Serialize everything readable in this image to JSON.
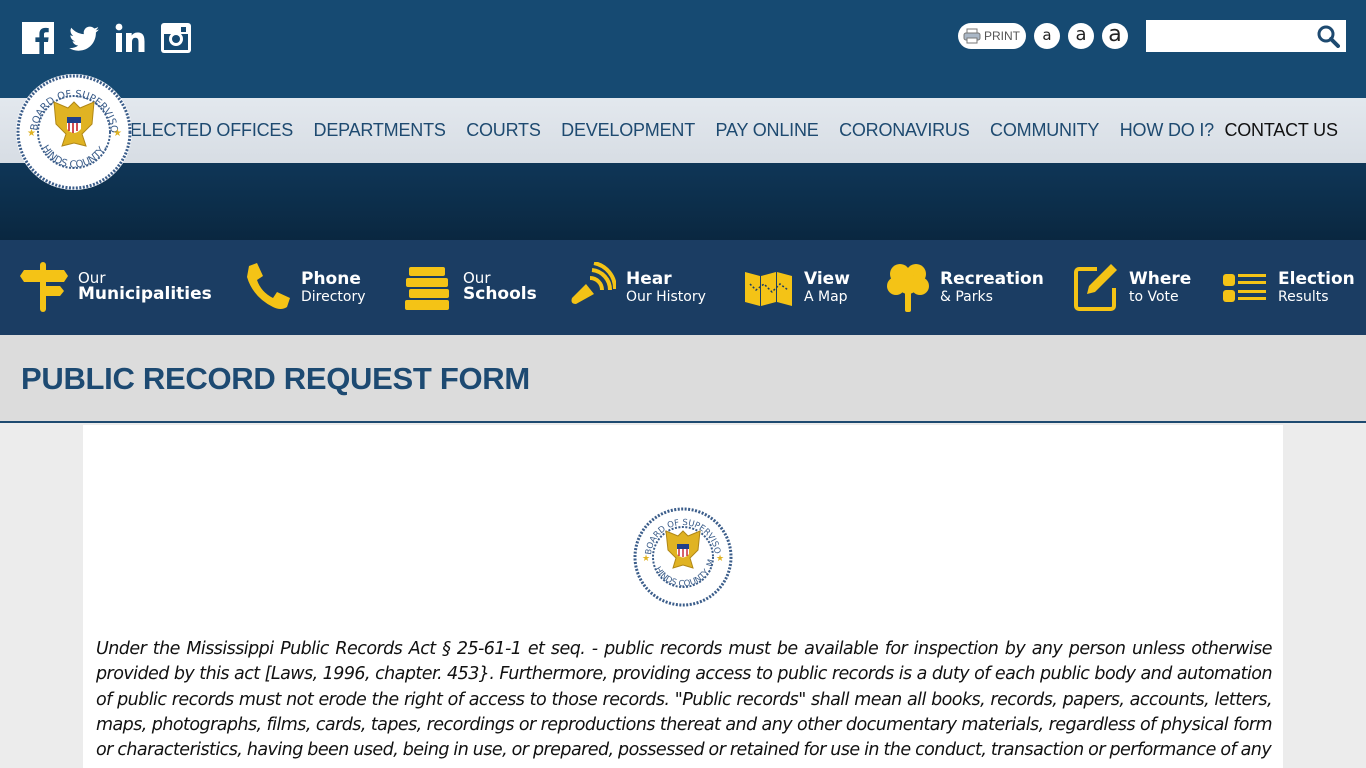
{
  "header": {
    "social": [
      {
        "name": "facebook-icon",
        "label": "Facebook"
      },
      {
        "name": "twitter-icon",
        "label": "Twitter"
      },
      {
        "name": "linkedin-icon",
        "label": "LinkedIn"
      },
      {
        "name": "instagram-icon",
        "label": "Instagram"
      }
    ],
    "print_label": "PRINT",
    "font_size_buttons": [
      "a",
      "a",
      "a"
    ],
    "search": {
      "value": "",
      "placeholder": ""
    }
  },
  "logo": {
    "top_text": "BOARD OF SUPERVISORS",
    "bottom_text": "HINDS COUNTY, MS"
  },
  "nav": {
    "items": [
      "ELECTED OFFICES",
      "DEPARTMENTS",
      "COURTS",
      "DEVELOPMENT",
      "PAY ONLINE",
      "CORONAVIRUS",
      "COMMUNITY",
      "HOW DO I?",
      "CONTACT US"
    ]
  },
  "quick_links": [
    {
      "small": "Our",
      "big": "Municipalities",
      "icon": "signpost-icon"
    },
    {
      "big": "Phone",
      "sub": "Directory",
      "icon": "phone-icon"
    },
    {
      "small": "Our",
      "big": "Schools",
      "icon": "books-icon"
    },
    {
      "big": "Hear",
      "sub": "Our History",
      "icon": "megaphone-icon"
    },
    {
      "big": "View",
      "sub": "A Map",
      "icon": "map-icon"
    },
    {
      "big": "Recreation",
      "sub": "& Parks",
      "icon": "tree-icon"
    },
    {
      "big": "Where",
      "sub": "to Vote",
      "icon": "edit-icon"
    },
    {
      "big": "Election",
      "sub": "Results",
      "icon": "list-icon"
    }
  ],
  "page": {
    "title": "PUBLIC RECORD REQUEST FORM",
    "intro": "Under the Mississippi Public Records Act § 25-61-1 et seq.  - public records must be available for inspection by any person unless otherwise provided by this act [Laws, 1996, chapter. 453}. Furthermore, providing access to public records is a duty of each public body and automation of public records must not erode the right of access to those records. \"Public records\" shall mean all books, records, papers, accounts, letters, maps, photographs, films, cards, tapes, recordings or reproductions thereat and any other documentary materials, regardless of physical form or characteristics, having been used, being in use, or prepared, possessed or retained for use in the conduct, transaction or performance of any"
  },
  "colors": {
    "header_bg": "#164a72",
    "nav_bg": "#dde2e8",
    "quicklinks_bg": "#1b3d63",
    "accent_yellow": "#f4c316",
    "title_color": "#1d4a72"
  }
}
